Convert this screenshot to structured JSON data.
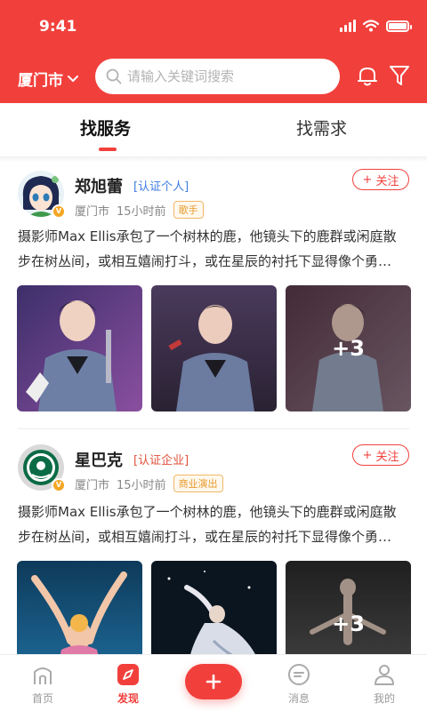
{
  "status_bar": {
    "time": "9:41"
  },
  "header": {
    "city": "厦门市",
    "search_placeholder": "请输入关键词搜索",
    "bg_color": "#f1403c"
  },
  "tabs": [
    {
      "label": "找服务",
      "active": true
    },
    {
      "label": "找需求",
      "active": false
    }
  ],
  "posts": [
    {
      "name": "郑旭蕾",
      "cert": "[认证个人]",
      "location": "厦门市",
      "time": "15小时前",
      "tag": "歌手",
      "follow_label": "关注",
      "desc_line1": "摄影师Max Ellis承包了一个树林的鹿，他镜头下的鹿群或闲庭散",
      "desc_line2": "步在树丛间，或相互嬉闹打斗，或在星辰的衬托下显得像个勇…",
      "more_count": "+3"
    },
    {
      "name": "星巴克",
      "cert": "[认证企业]",
      "location": "厦门市",
      "time": "15小时前",
      "tag": "商业演出",
      "follow_label": "关注",
      "desc_line1": "摄影师Max Ellis承包了一个树林的鹿，他镜头下的鹿群或闲庭散",
      "desc_line2": "步在树丛间，或相互嬉闹打斗，或在星辰的衬托下显得像个勇…",
      "more_count": "+3"
    }
  ],
  "bottom_nav": [
    {
      "label": "首页",
      "icon": "home-icon"
    },
    {
      "label": "发现",
      "icon": "discover-icon",
      "active": true
    },
    {
      "label": "",
      "icon": "plus-icon"
    },
    {
      "label": "消息",
      "icon": "message-icon"
    },
    {
      "label": "我的",
      "icon": "profile-icon"
    }
  ],
  "colors": {
    "accent": "#f1403c",
    "cert_person": "#3d7be0",
    "cert_company": "#e0503a",
    "tag": "#e79a2b"
  }
}
